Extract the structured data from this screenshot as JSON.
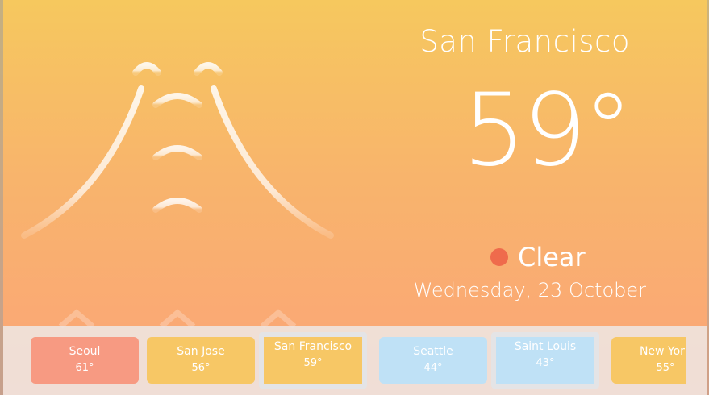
{
  "weather": {
    "city": "San Francisco",
    "temperature": "59°",
    "condition": "Clear",
    "date": "Wednesday, 23 October",
    "condition_color": "#ef6b4c",
    "illustration_icon": "golden-gate-bridge-icon"
  },
  "cities": [
    {
      "name": "Seoul",
      "temp": "61°",
      "color": "#f79a82",
      "selected": false
    },
    {
      "name": "San Jose",
      "temp": "56°",
      "color": "#f7c765",
      "selected": false
    },
    {
      "name": "San Francisco",
      "temp": "59°",
      "color": "#f7c765",
      "selected": true
    },
    {
      "name": "Seattle",
      "temp": "44°",
      "color": "#bfe1f6",
      "selected": false
    },
    {
      "name": "Saint Louis",
      "temp": "43°",
      "color": "#bfe1f6",
      "selected": true
    },
    {
      "name": "New York",
      "temp": "55°",
      "color": "#f7c765",
      "selected": false
    }
  ]
}
